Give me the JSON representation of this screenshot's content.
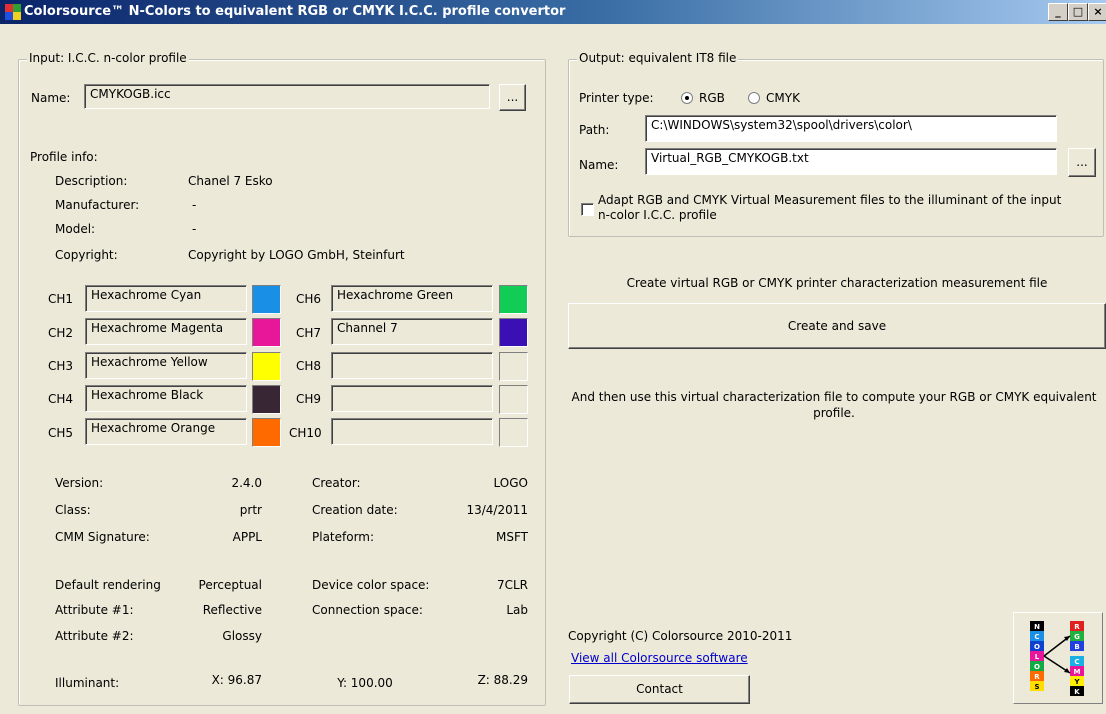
{
  "window": {
    "title": "Colorsource™ N-Colors to equivalent RGB or CMYK I.C.C. profile convertor"
  },
  "input": {
    "group_label": "Input: I.C.C. n-color profile",
    "name_label": "Name:",
    "name_value": "CMYKOGB.icc",
    "browse_label": "...",
    "profile_info_label": "Profile info:",
    "description_label": "Description:",
    "description_value": "Chanel 7 Esko",
    "manufacturer_label": "Manufacturer:",
    "manufacturer_value": "-",
    "model_label": "Model:",
    "model_value": "-",
    "copyright_label": "Copyright:",
    "copyright_value": "Copyright by LOGO GmbH, Steinfurt",
    "channels": [
      {
        "label": "CH1",
        "name": "Hexachrome Cyan",
        "color": "#1a8fe6"
      },
      {
        "label": "CH2",
        "name": "Hexachrome Magenta",
        "color": "#e8179a"
      },
      {
        "label": "CH3",
        "name": "Hexachrome Yellow",
        "color": "#ffff00"
      },
      {
        "label": "CH4",
        "name": "Hexachrome Black",
        "color": "#382634"
      },
      {
        "label": "CH5",
        "name": "Hexachrome Orange",
        "color": "#ff6a00"
      },
      {
        "label": "CH6",
        "name": "Hexachrome Green",
        "color": "#11cc55"
      },
      {
        "label": "CH7",
        "name": "Channel 7",
        "color": "#3a10b4"
      },
      {
        "label": "CH8",
        "name": "",
        "color": "#ece9d8"
      },
      {
        "label": "CH9",
        "name": "",
        "color": "#ece9d8"
      },
      {
        "label": "CH10",
        "name": "",
        "color": "#ece9d8"
      }
    ],
    "version_label": "Version:",
    "version_value": "2.4.0",
    "class_label": "Class:",
    "class_value": "prtr",
    "cmm_label": "CMM Signature:",
    "cmm_value": "APPL",
    "creator_label": "Creator:",
    "creator_value": "LOGO",
    "creation_date_label": "Creation date:",
    "creation_date_value": "13/4/2011",
    "plateform_label": "Plateform:",
    "plateform_value": "MSFT",
    "rendering_label": "Default rendering",
    "rendering_value": "Perceptual",
    "attr1_label": "Attribute #1:",
    "attr1_value": "Reflective",
    "attr2_label": "Attribute #2:",
    "attr2_value": "Glossy",
    "device_space_label": "Device color space:",
    "device_space_value": "7CLR",
    "connection_space_label": "Connection space:",
    "connection_space_value": "Lab",
    "illuminant_label": "Illuminant:",
    "illuminant_x": "X: 96.87",
    "illuminant_y": "Y: 100.00",
    "illuminant_z": "Z: 88.29"
  },
  "output": {
    "group_label": "Output: equivalent IT8 file",
    "printer_type_label": "Printer type:",
    "rgb_label": "RGB",
    "cmyk_label": "CMYK",
    "selected_printer_type": "RGB",
    "path_label": "Path:",
    "path_value": "C:\\WINDOWS\\system32\\spool\\drivers\\color\\",
    "name_label": "Name:",
    "name_value": "Virtual_RGB_CMYKOGB.txt",
    "browse_label": "...",
    "adapt_label_line1": "Adapt RGB and CMYK Virtual Measurement files to the illuminant of the input",
    "adapt_label_line2": "n-color I.C.C. profile",
    "adapt_checked": false
  },
  "actions": {
    "create_caption": "Create virtual RGB or CMYK printer characterization measurement file",
    "create_button": "Create and save",
    "then_line1": "And then use this virtual characterization file to compute your RGB or CMYK equivalent",
    "then_line2": "profile."
  },
  "footer": {
    "copyright": "Copyright (C) Colorsource 2010-2011",
    "link": "View all Colorsource software",
    "contact_button": "Contact"
  },
  "logo": {
    "left_letters": [
      "N",
      "C",
      "O",
      "L",
      "O",
      "R",
      "S"
    ],
    "right_letters": [
      "R",
      "G",
      "B",
      "C",
      "M",
      "Y",
      "K"
    ]
  }
}
